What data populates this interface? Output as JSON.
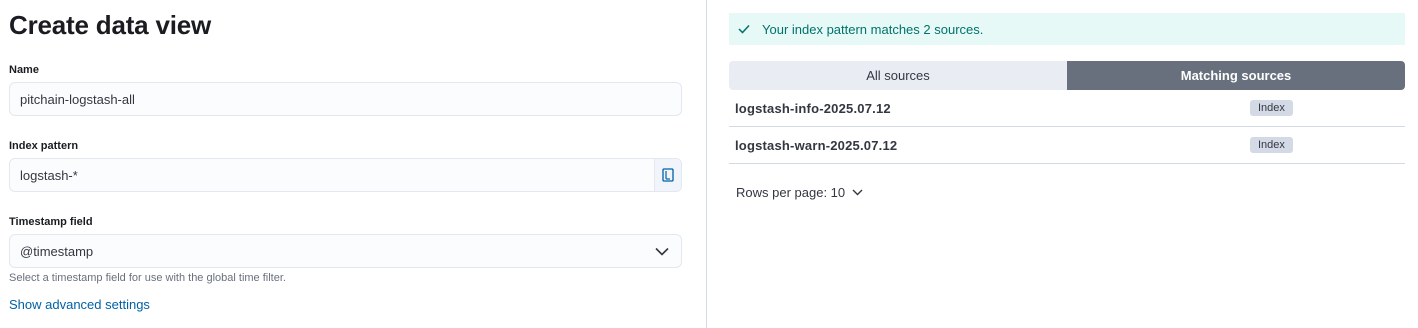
{
  "form": {
    "title": "Create data view",
    "name_label": "Name",
    "name_value": "pitchain-logstash-all",
    "index_label": "Index pattern",
    "index_value": "logstash-*",
    "timestamp_label": "Timestamp field",
    "timestamp_value": "@timestamp",
    "timestamp_help": "Select a timestamp field for use with the global time filter.",
    "advanced_link": "Show advanced settings"
  },
  "preview": {
    "callout": "Your index pattern matches 2 sources.",
    "tabs": [
      {
        "label": "All sources",
        "selected": false
      },
      {
        "label": "Matching sources",
        "selected": true
      }
    ],
    "rows": [
      {
        "name": "logstash-info-2025.07.12",
        "badge": "Index"
      },
      {
        "name": "logstash-warn-2025.07.12",
        "badge": "Index"
      }
    ],
    "rows_per_page": "Rows per page: 10"
  },
  "colors": {
    "accent_link": "#0061a6",
    "success_bg": "#e6f9f7",
    "success_text": "#00726b",
    "selected_tab": "#69707d"
  },
  "icons": {
    "index_append": "book-icon",
    "timestamp_dropdown": "chevron-down-icon",
    "callout": "check-icon",
    "rows_per_page": "chevron-down-icon"
  }
}
